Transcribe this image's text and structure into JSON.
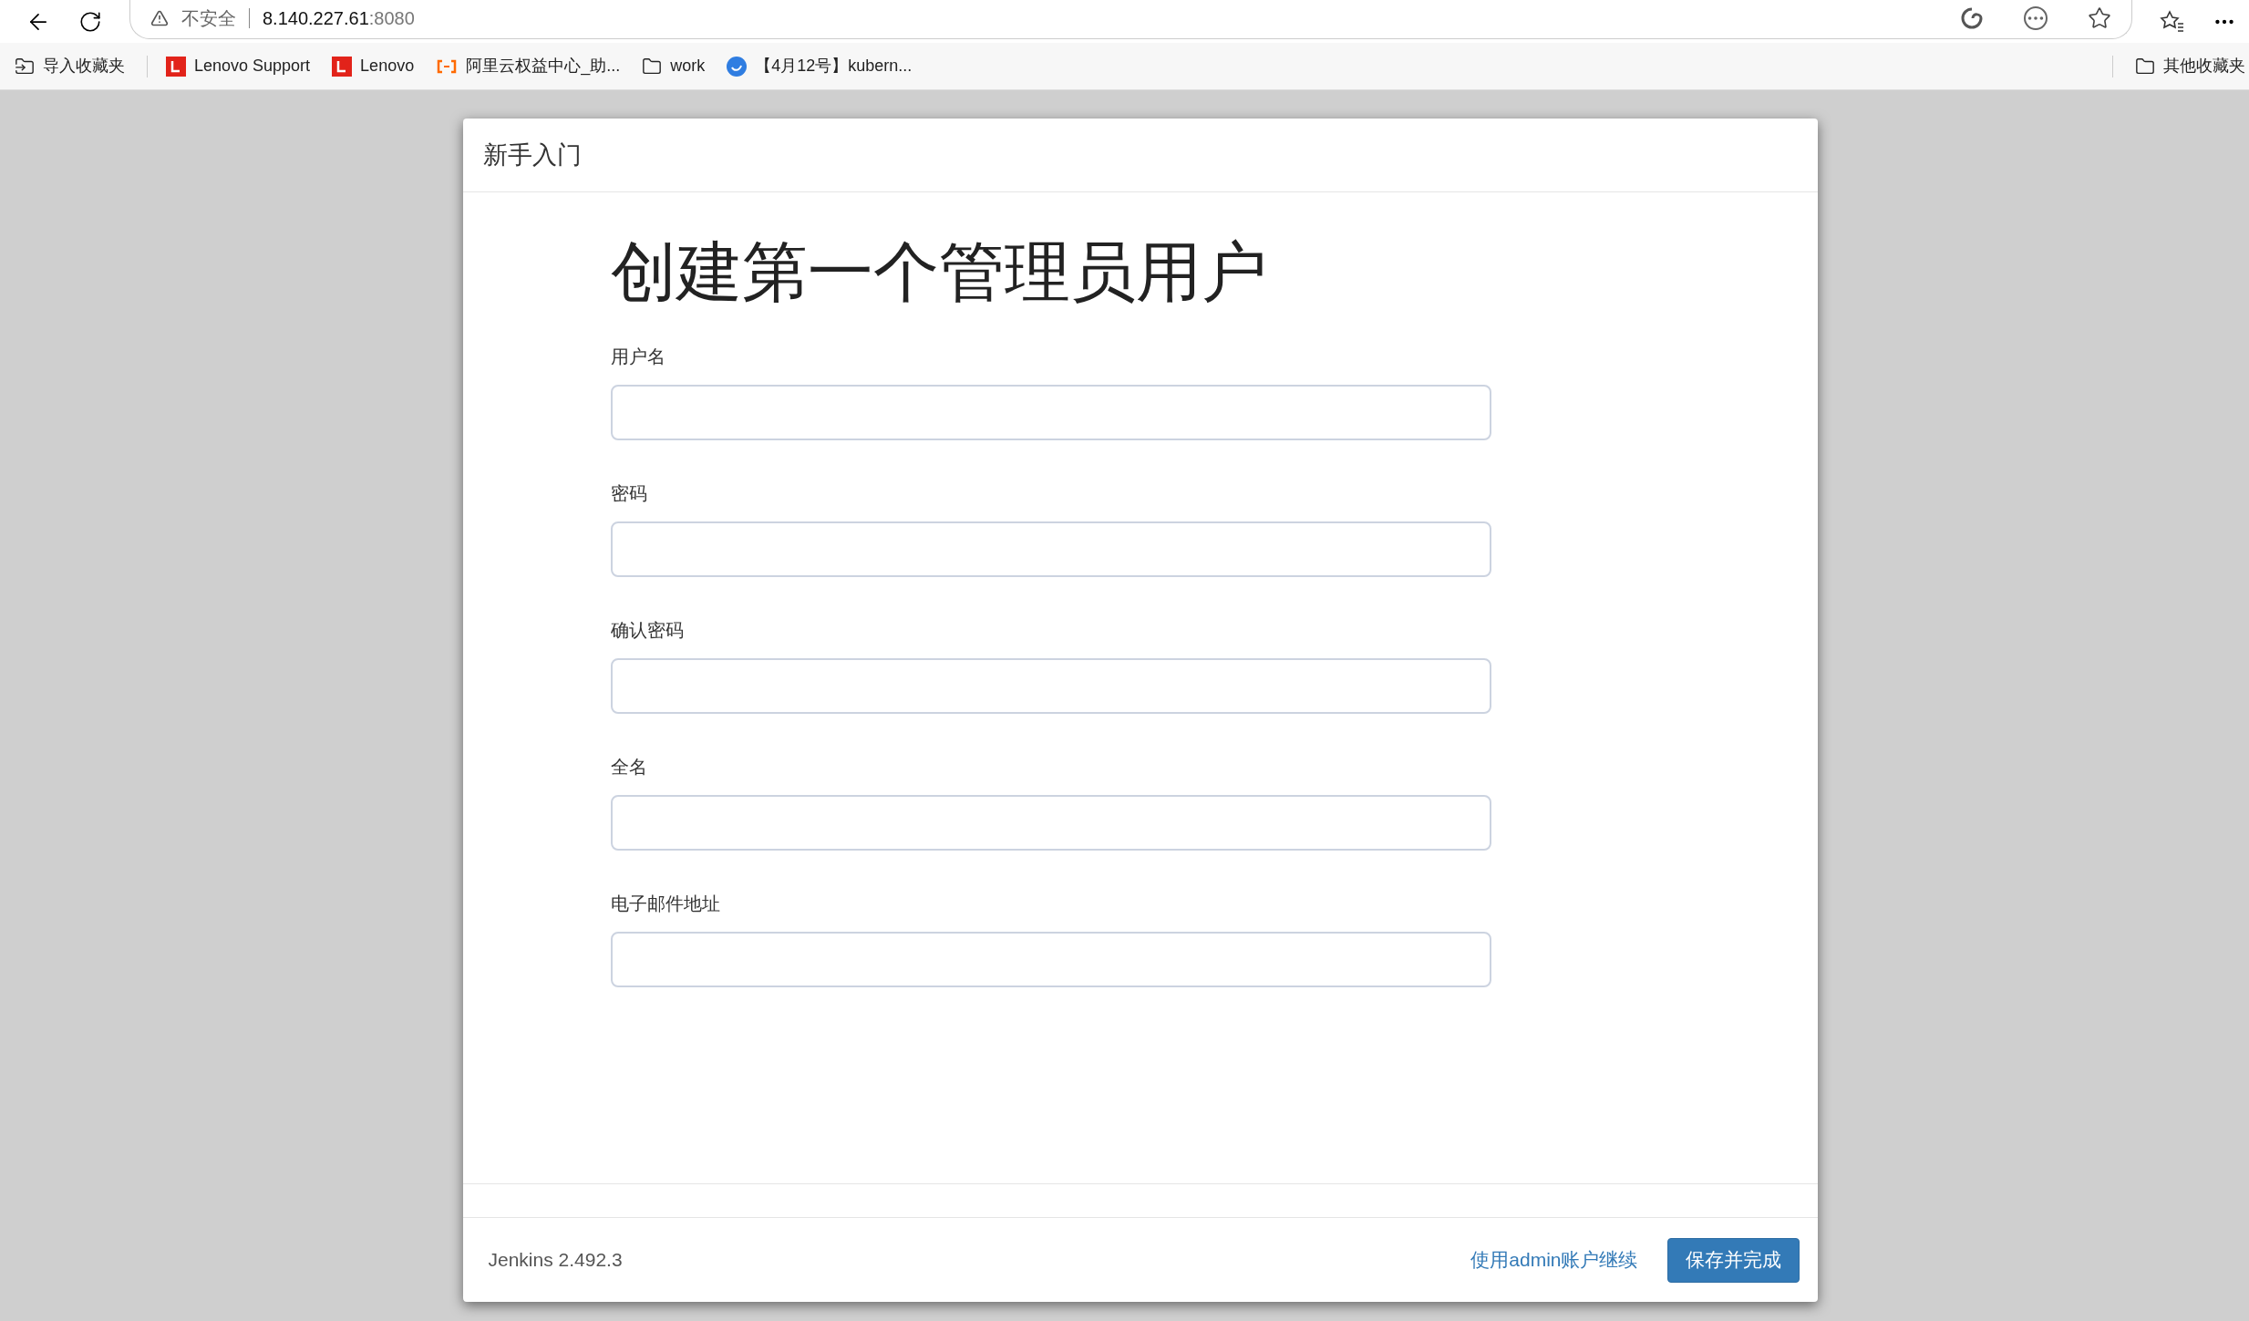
{
  "browser": {
    "security": "不安全",
    "url_host": "8.140.227.61",
    "url_port": ":8080"
  },
  "bookmarks": [
    {
      "label": "导入收藏夹",
      "kind": "import"
    },
    {
      "label": "Lenovo Support",
      "kind": "lenovo"
    },
    {
      "label": "Lenovo",
      "kind": "lenovo"
    },
    {
      "label": "阿里云权益中心_助...",
      "kind": "aliyun"
    },
    {
      "label": "work",
      "kind": "folder"
    },
    {
      "label": "【4月12号】kubern...",
      "kind": "blue"
    }
  ],
  "other_bookmarks": "其他收藏夹",
  "dialog": {
    "header": "新手入门",
    "title": "创建第一个管理员用户",
    "fields": [
      {
        "label": "用户名"
      },
      {
        "label": "密码"
      },
      {
        "label": "确认密码"
      },
      {
        "label": "全名"
      },
      {
        "label": "电子邮件地址"
      }
    ],
    "version": "Jenkins 2.492.3",
    "link": "使用admin账户继续",
    "button": "保存并完成"
  }
}
